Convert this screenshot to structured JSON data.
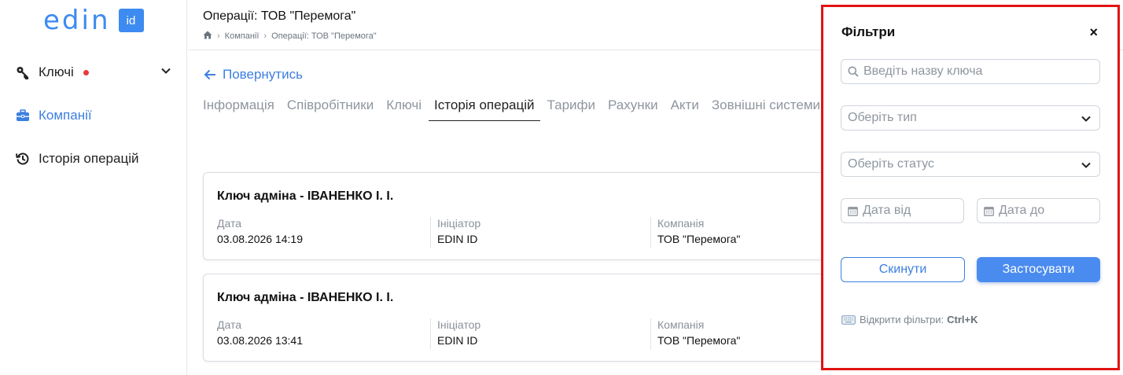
{
  "logo": {
    "text": "edin",
    "badge": "id"
  },
  "sidebar": {
    "items": [
      {
        "label": "Ключі",
        "icon": "key-icon",
        "has_dot": true,
        "expandable": true
      },
      {
        "label": "Компанії",
        "icon": "briefcase-icon",
        "active": true
      },
      {
        "label": "Історія операцій",
        "icon": "history-icon"
      }
    ]
  },
  "header": {
    "title": "Операції: ТОВ \"Перемога\"",
    "breadcrumb": [
      "Компанії",
      "Операції: ТОВ \"Перемога\""
    ]
  },
  "main": {
    "back_label": "Повернутись",
    "tabs": [
      "Інформація",
      "Співробітники",
      "Ключі",
      "Історія операцій",
      "Тарифи",
      "Рахунки",
      "Акти",
      "Зовнішні системи"
    ],
    "active_tab": "Історія операцій",
    "cards": [
      {
        "title": "Ключ адміна - ІВАНЕНКО І. І.",
        "date_label": "Дата",
        "date": "03.08.2026 14:19",
        "initiator_label": "Ініціатор",
        "initiator": "EDIN ID",
        "company_label": "Компанія",
        "company": "ТОВ \"Перемога\""
      },
      {
        "title": "Ключ адміна - ІВАНЕНКО І. І.",
        "date_label": "Дата",
        "date": "03.08.2026 13:41",
        "initiator_label": "Ініціатор",
        "initiator": "EDIN ID",
        "company_label": "Компанія",
        "company": "ТОВ \"Перемога\""
      }
    ]
  },
  "filters": {
    "title": "Фільтри",
    "close": "×",
    "search_placeholder": "Введіть назву ключа",
    "type_placeholder": "Оберіть тип",
    "status_placeholder": "Оберіть статус",
    "date_from_placeholder": "Дата від",
    "date_to_placeholder": "Дата до",
    "reset_label": "Скинути",
    "apply_label": "Застосувати",
    "hint_text": "Відкрити фільтри:",
    "hint_shortcut": "Ctrl+K"
  },
  "colors": {
    "accent": "#3d7fe0",
    "highlight_border": "#e21313",
    "dot": "#e83a3a"
  }
}
